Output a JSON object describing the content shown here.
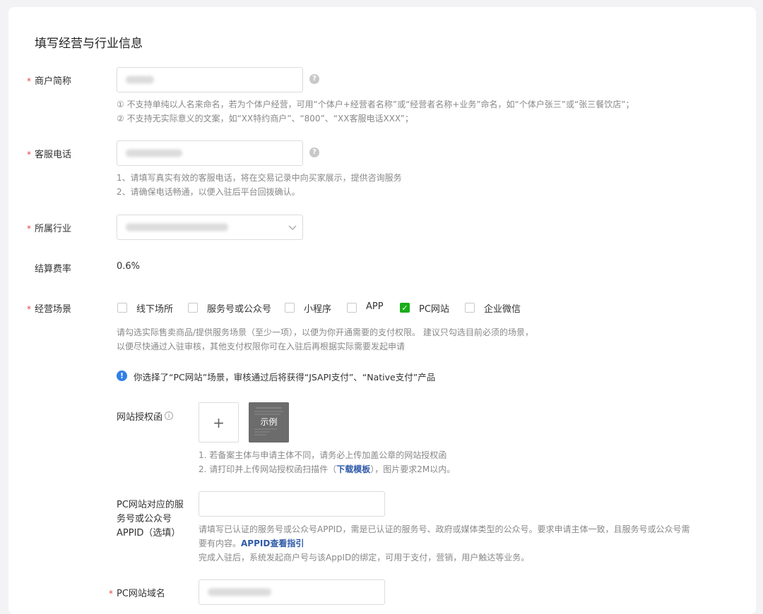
{
  "title": "填写经营与行业信息",
  "required_mark": "*",
  "merchant_name": {
    "label": "商户简称",
    "hint1": "① 不支持单纯以人名来命名，若为个体户经营，可用“个体户+经营者名称”或“经营者名称+业务”命名，如“个体户张三”或“张三餐饮店”；",
    "hint2": "② 不支持无实际意义的文案，如“XX特约商户”、“800”、“XX客服电话XXX”；"
  },
  "service_phone": {
    "label": "客服电话",
    "hint1": "1、请填写真实有效的客服电话，将在交易记录中向买家展示，提供咨询服务",
    "hint2": "2、请确保电话畅通，以便入驻后平台回拨确认。"
  },
  "industry": {
    "label": "所属行业"
  },
  "rate": {
    "label": "结算费率",
    "value": "0.6%"
  },
  "scenes": {
    "label": "经营场景",
    "options": [
      {
        "label": "线下场所",
        "checked": false
      },
      {
        "label": "服务号或公众号",
        "checked": false
      },
      {
        "label": "小程序",
        "checked": false
      },
      {
        "label": "APP",
        "checked": false
      },
      {
        "label": "PC网站",
        "checked": true
      },
      {
        "label": "企业微信",
        "checked": false
      }
    ],
    "hint1": "请勾选实际售卖商品/提供服务场景（至少一项），以便为你开通需要的支付权限。 建议只勾选目前必须的场景，",
    "hint2": "以便尽快通过入驻审核，其他支付权限你可在入驻后再根据实际需要发起申请",
    "notice": "你选择了“PC网站”场景，审核通过后将获得“JSAPI支付”、“Native支付”产品"
  },
  "auth_letter": {
    "label": "网站授权函",
    "plus": "+",
    "sample": "示例",
    "hint1": "1. 若备案主体与申请主体不同，请务必上传加盖公章的网站授权函",
    "hint2_prefix": "2. 请打印并上传网站授权函扫描件（",
    "hint2_link": "下载模板",
    "hint2_suffix": "），图片要求2M以内。"
  },
  "appid": {
    "label1": "PC网站对应的服",
    "label2": "务号或公众号",
    "label3": "APPID（选填）",
    "hint1": "请填写已认证的服务号或公众号APPID，需是已认证的服务号、政府或媒体类型的公众号。要求申请主体一致，且服务号或公众号需",
    "hint2_prefix": "要有内容。",
    "hint2_link": "APPID查看指引",
    "hint3": "完成入驻后，系统发起商户号与该AppID的绑定，可用于支付，营销，用户触达等业务。"
  },
  "domain": {
    "label": "PC网站域名"
  },
  "colors": {
    "accent": "#1aad19",
    "link": "#2f5aa8",
    "required": "#e54545",
    "info": "#2f7fe8"
  }
}
